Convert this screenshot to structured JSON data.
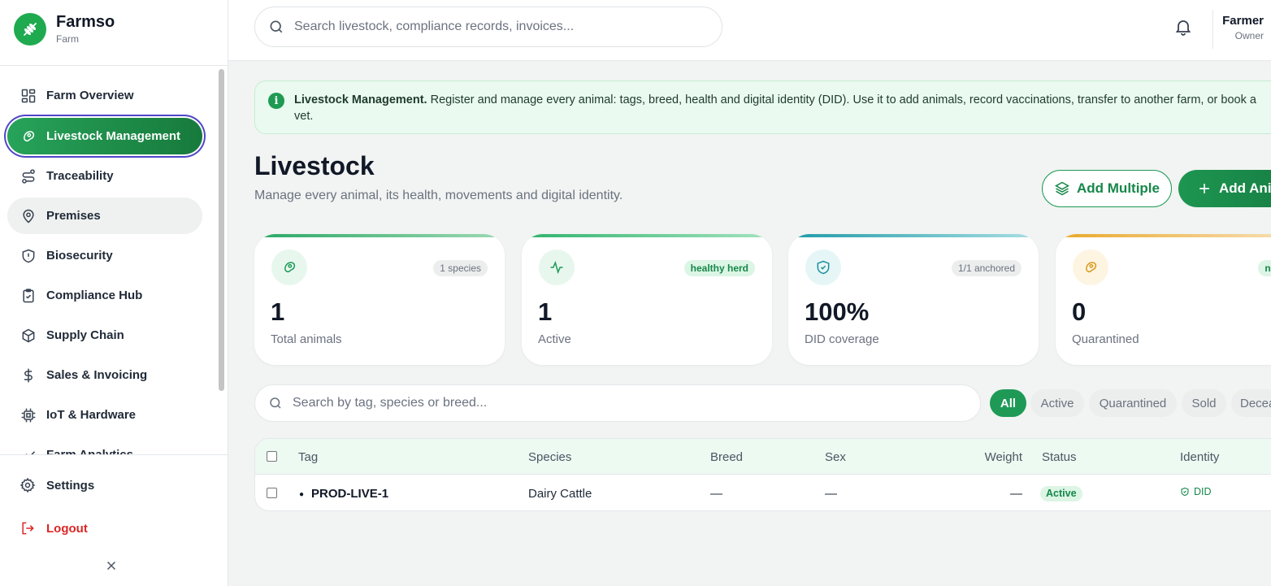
{
  "brand": {
    "name": "Farmso",
    "subtitle": "Farm"
  },
  "nav": {
    "items": [
      {
        "label": "Farm Overview"
      },
      {
        "label": "Livestock Management"
      },
      {
        "label": "Traceability"
      },
      {
        "label": "Premises"
      },
      {
        "label": "Biosecurity"
      },
      {
        "label": "Compliance Hub"
      },
      {
        "label": "Supply Chain"
      },
      {
        "label": "Sales & Invoicing"
      },
      {
        "label": "IoT & Hardware"
      },
      {
        "label": "Farm Analytics"
      }
    ],
    "active": "Livestock Management",
    "settings": "Settings",
    "logout": "Logout"
  },
  "topbar": {
    "search_placeholder": "Search livestock, compliance records, invoices...",
    "user_name": "Farmer",
    "user_role": "Owner"
  },
  "banner": {
    "title": "Livestock Management.",
    "text": " Register and manage every animal: tags, breed, health and digital identity (DID). Use it to add animals, record vaccinations, transfer to another farm, or book a vet."
  },
  "page": {
    "title": "Livestock",
    "subtitle": "Manage every animal, its health, movements and digital identity.",
    "add_multiple": "Add Multiple",
    "add_animal": "Add Animal"
  },
  "stats": [
    {
      "value": "1",
      "label": "Total animals",
      "badge": "1 species",
      "icon": "paw-icon"
    },
    {
      "value": "1",
      "label": "Active",
      "badge": "healthy herd",
      "icon": "activity-icon"
    },
    {
      "value": "100%",
      "label": "DID coverage",
      "badge": "1/1 anchored",
      "icon": "shield-check-icon"
    },
    {
      "value": "0",
      "label": "Quarantined",
      "badge": "none",
      "icon": "paw-icon"
    }
  ],
  "filters": {
    "search_placeholder": "Search by tag, species or breed...",
    "chips": [
      "All",
      "Active",
      "Quarantined",
      "Sold",
      "Deceased"
    ],
    "selected": "All"
  },
  "table": {
    "columns": [
      "Tag",
      "Species",
      "Breed",
      "Sex",
      "Weight",
      "Status",
      "Identity"
    ],
    "rows": [
      {
        "tag": "PROD-LIVE-1",
        "species": "Dairy Cattle",
        "breed": "—",
        "sex": "—",
        "weight": "—",
        "status": "Active",
        "identity": "DID"
      }
    ]
  },
  "colors": {
    "accent": "#1e9a56",
    "danger": "#dc2626",
    "focus_ring": "#4f46c8"
  }
}
